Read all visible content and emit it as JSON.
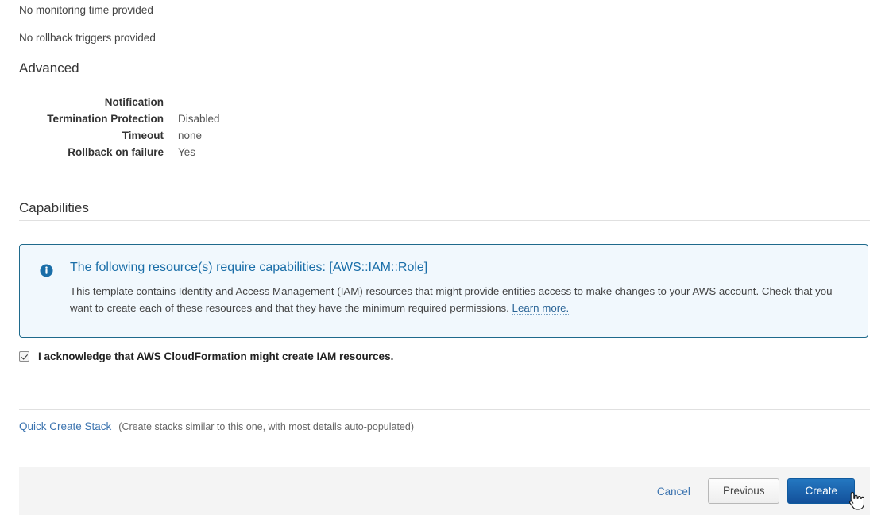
{
  "review": {
    "notes": [
      "No monitoring time provided",
      "No rollback triggers provided"
    ],
    "advanced": {
      "title": "Advanced",
      "rows": [
        {
          "label": "Notification",
          "value": ""
        },
        {
          "label": "Termination Protection",
          "value": "Disabled"
        },
        {
          "label": "Timeout",
          "value": "none"
        },
        {
          "label": "Rollback on failure",
          "value": "Yes"
        }
      ]
    }
  },
  "capabilities": {
    "title": "Capabilities",
    "callout": {
      "icon": "info-circle-icon",
      "heading": "The following resource(s) require capabilities: [AWS::IAM::Role]",
      "body_before_link": "This template contains Identity and Access Management (IAM) resources that might provide entities access to make changes to your AWS account. Check that you want to create each of these resources and that they have the minimum required permissions. ",
      "link_text": "Learn more.",
      "border_color": "#1f6a8c",
      "background_color": "#f1f8fd"
    },
    "acknowledge": {
      "checked": true,
      "label": "I acknowledge that AWS CloudFormation might create IAM resources."
    }
  },
  "quick_create": {
    "link_text": "Quick Create Stack",
    "note": "(Create stacks similar to this one, with most details auto-populated)"
  },
  "footer": {
    "cancel_label": "Cancel",
    "previous_label": "Previous",
    "create_label": "Create",
    "create_color": "#13509a",
    "bar_background": "#f4f4f4"
  },
  "cursor": {
    "type": "pointing-hand-cursor"
  }
}
